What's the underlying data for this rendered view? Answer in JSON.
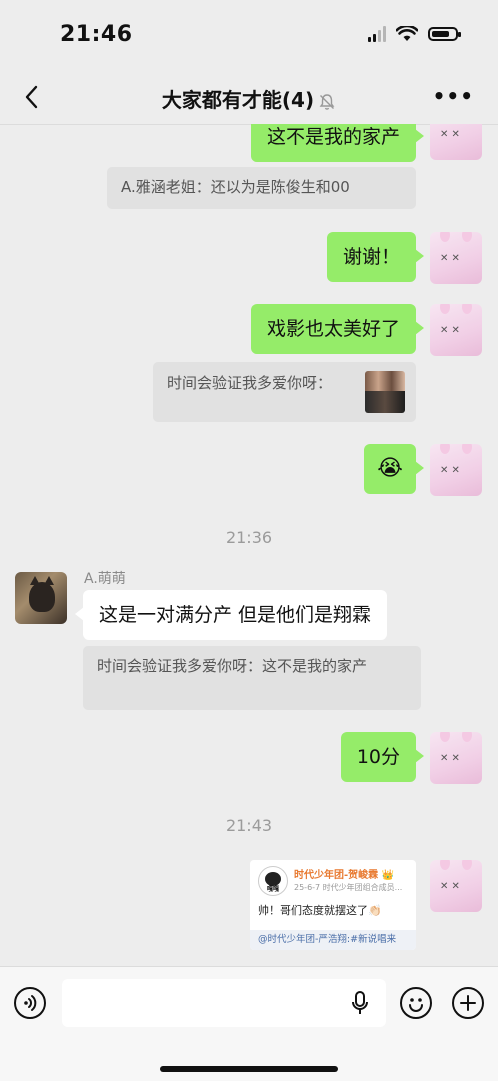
{
  "status_bar": {
    "time": "21:46"
  },
  "header": {
    "title": "大家都有才能(4)"
  },
  "messages": {
    "m1": "这不是我的家产",
    "q1": "A.雅涵老姐：还以为是陈俊生和00",
    "m2": "谢谢！",
    "m3": "戏影也太美好了",
    "q2": "时间会验证我多爱你呀：",
    "m4_emoji": "😭",
    "ts1": "21:36",
    "sender": "A.萌萌",
    "m5": "这是一对满分产 但是他们是翔霖",
    "q3": "时间会验证我多爱你呀：这不是我的家产",
    "m6": "10分",
    "ts2": "21:43"
  },
  "shared_card": {
    "avatar_label": "嘎嘎",
    "name": "时代少年团-贺峻霖 👑",
    "meta": "25-6-7  时代少年团组合成员...",
    "text": "帅！哥们态度就摆这了👏🏻",
    "link": "@时代少年团-严浩翔:#新说唱来"
  },
  "colors": {
    "my_bubble": "#95ec69",
    "background": "#ededed"
  }
}
